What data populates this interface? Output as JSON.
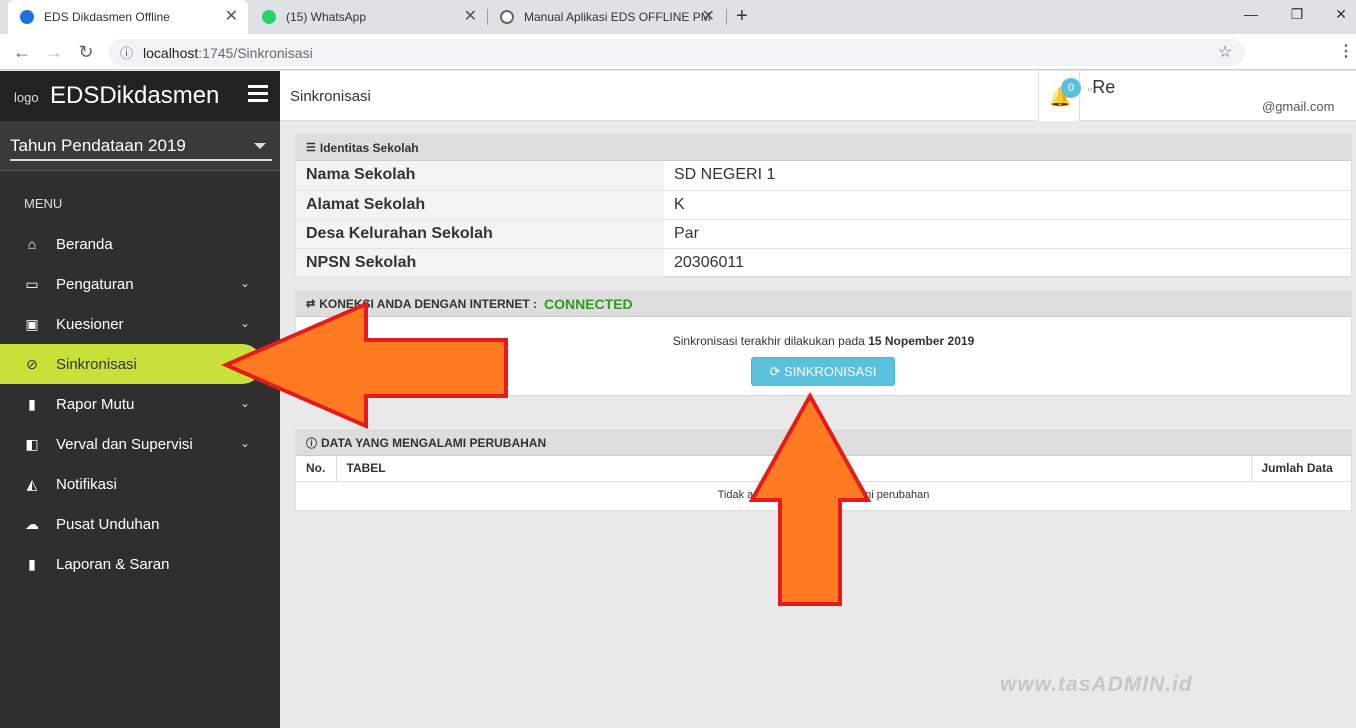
{
  "browser": {
    "tabs": [
      {
        "title": "EDS Dikdasmen Offline"
      },
      {
        "title": "(15) WhatsApp"
      },
      {
        "title": "Manual Aplikasi EDS OFFLINE PM"
      }
    ],
    "url_host": "localhost",
    "url_path": ":1745/Sinkronisasi"
  },
  "sidebar": {
    "brand": "EDSDikdasmen",
    "logo_alt": "logo",
    "year": "Tahun Pendataan 2019",
    "menu_label": "MENU",
    "items": [
      {
        "label": "Beranda",
        "icon": "home-icon"
      },
      {
        "label": "Pengaturan",
        "icon": "monitor-icon"
      },
      {
        "label": "Kuesioner",
        "icon": "ticket-icon"
      },
      {
        "label": "Sinkronisasi",
        "icon": "check-circle-icon"
      },
      {
        "label": "Rapor Mutu",
        "icon": "book-icon"
      },
      {
        "label": "Verval dan Supervisi",
        "icon": "door-icon"
      },
      {
        "label": "Notifikasi",
        "icon": "bell-icon"
      },
      {
        "label": "Pusat Unduhan",
        "icon": "cloud-download-icon"
      },
      {
        "label": "Laporan & Saran",
        "icon": "book-icon"
      }
    ]
  },
  "header": {
    "title": "Sinkronisasi",
    "notif_count": "0",
    "user_name": "Re",
    "user_email": "@gmail.com"
  },
  "identitas": {
    "heading": "Identitas Sekolah",
    "rows": [
      {
        "key": "Nama Sekolah",
        "value": "SD NEGERI 1"
      },
      {
        "key": "Alamat Sekolah",
        "value": "K"
      },
      {
        "key": "Desa Kelurahan Sekolah",
        "value": "Par"
      },
      {
        "key": "NPSN Sekolah",
        "value": "20306011"
      }
    ]
  },
  "koneksi": {
    "heading": "KONEKSI ANDA DENGAN INTERNET :",
    "status": "CONNECTED",
    "last_sync_text": "Sinkronisasi terakhir dilakukan pada",
    "last_sync_date": "15 Nopember 2019",
    "button": "SINKRONISASI"
  },
  "perubahan": {
    "heading": "DATA YANG MENGALAMI PERUBAHAN",
    "columns": [
      "No.",
      "TABEL",
      "Jumlah Data"
    ],
    "empty_text": "Tidak ada data yang mengalami perubahan"
  },
  "watermark": "www.tasADMIN.id",
  "colors": {
    "accent": "#c9e03a",
    "sidebar": "#2f2f2f",
    "button": "#5bc0de",
    "arrow": "#ff7b22",
    "connected": "#2e9a1e"
  }
}
